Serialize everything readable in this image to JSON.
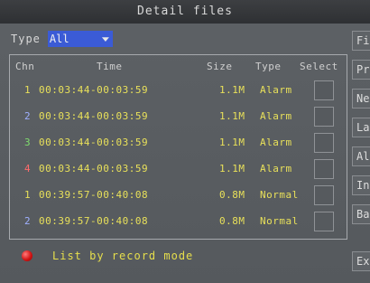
{
  "window": {
    "title": "Detail files"
  },
  "filter": {
    "type_label": "Type",
    "type_value": "All"
  },
  "table": {
    "headers": {
      "chn": "Chn",
      "time": "Time",
      "size": "Size",
      "type": "Type",
      "select": "Select"
    },
    "rows": [
      {
        "chn": "1",
        "chn_color": "#e8e05a",
        "time": "00:03:44-00:03:59",
        "size": "1.1M",
        "type": "Alarm"
      },
      {
        "chn": "2",
        "chn_color": "#9fb0ff",
        "time": "00:03:44-00:03:59",
        "size": "1.1M",
        "type": "Alarm"
      },
      {
        "chn": "3",
        "chn_color": "#7fdc6e",
        "time": "00:03:44-00:03:59",
        "size": "1.1M",
        "type": "Alarm"
      },
      {
        "chn": "4",
        "chn_color": "#ff6b6b",
        "time": "00:03:44-00:03:59",
        "size": "1.1M",
        "type": "Alarm"
      },
      {
        "chn": "1",
        "chn_color": "#e8e05a",
        "time": "00:39:57-00:40:08",
        "size": "0.8M",
        "type": "Normal"
      },
      {
        "chn": "2",
        "chn_color": "#9fb0ff",
        "time": "00:39:57-00:40:08",
        "size": "0.8M",
        "type": "Normal"
      }
    ]
  },
  "footer": {
    "text": "List by record mode"
  },
  "side_buttons": [
    {
      "label": "Fi"
    },
    {
      "label": "Pr"
    },
    {
      "label": "Ne"
    },
    {
      "label": "La"
    },
    {
      "label": "Al"
    },
    {
      "label": "In"
    },
    {
      "label": "Ba"
    },
    {
      "label": "Ex"
    }
  ]
}
